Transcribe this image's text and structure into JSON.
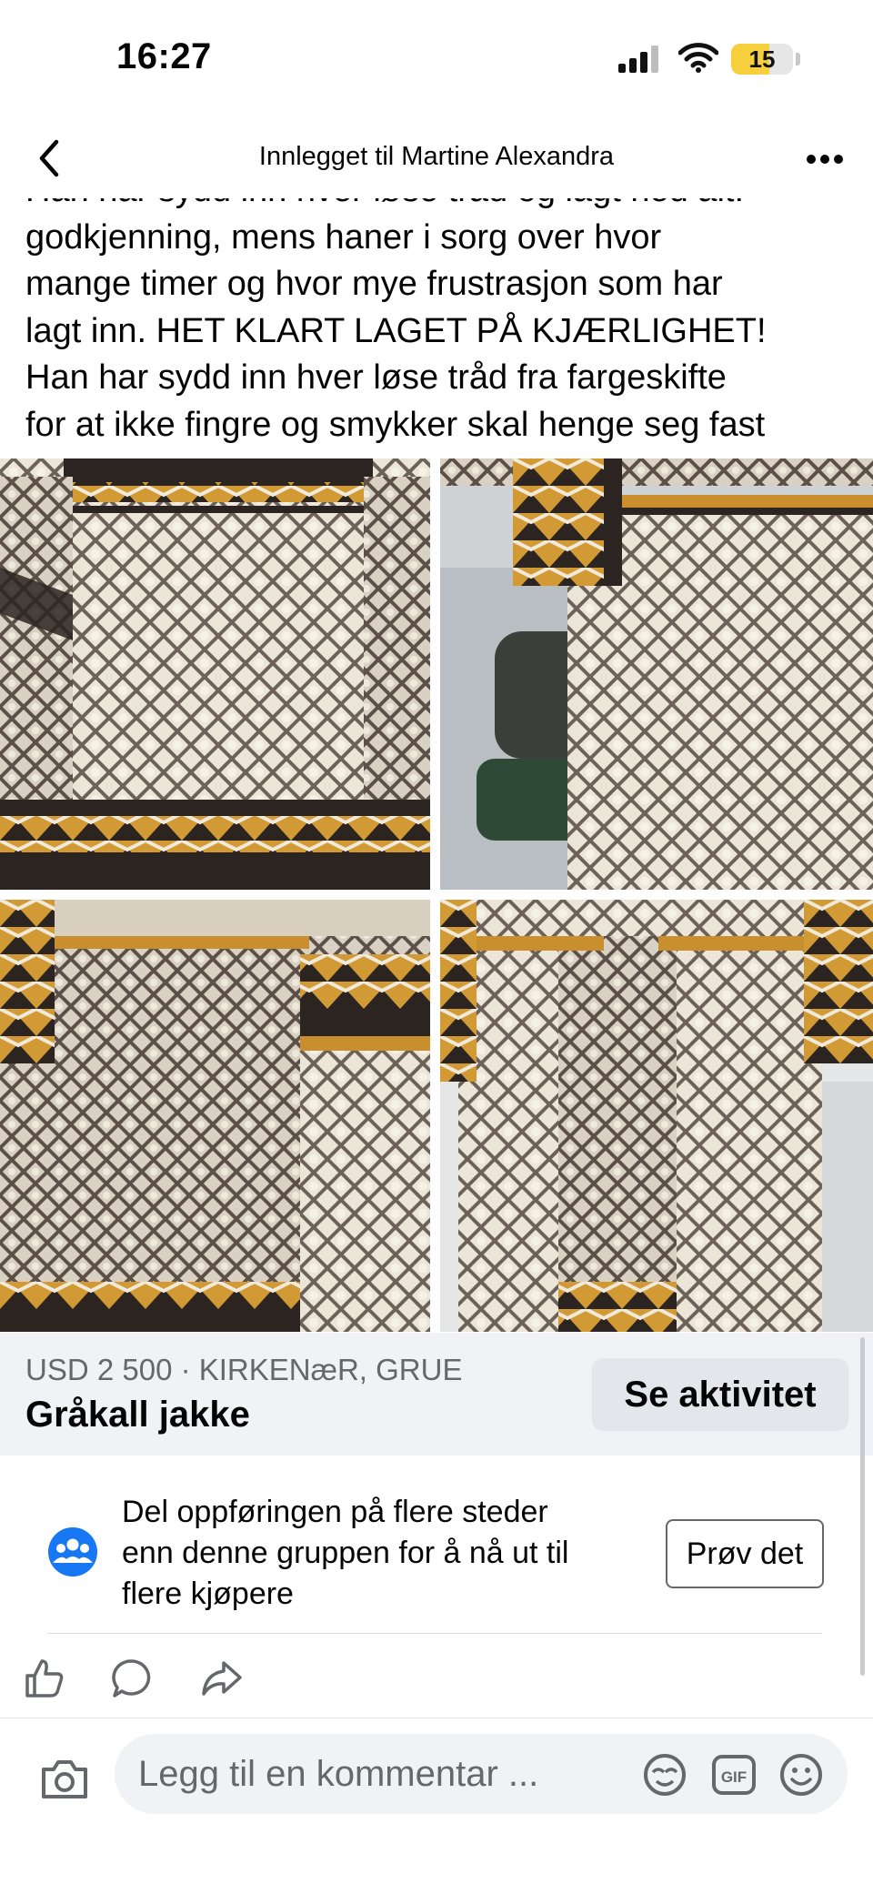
{
  "status_bar": {
    "time": "16:27",
    "battery": "15"
  },
  "nav": {
    "title": "Innlegget til Martine Alexandra"
  },
  "caption": {
    "lines": [
      "Han har sydd inn hver løse tråd og lagt ned alt.",
      "godkjenning, mens haner i sorg over hvor",
      "mange timer og hvor mye frustrasjon som har",
      "lagt inn. HET KLART LAGET PÅ KJÆRLIGHET!",
      "Han har sydd inn hver løse tråd fra fargeskifte",
      "for at ikke fingre og smykker skal henge seg fast"
    ]
  },
  "photos": [
    {
      "name": "photo-sweater-back"
    },
    {
      "name": "photo-sweater-side"
    },
    {
      "name": "photo-sweater-inside"
    },
    {
      "name": "photo-sweater-open"
    }
  ],
  "listing": {
    "price_location": "USD 2 500 · KIRKENæR, GRUE",
    "title": "Gråkall jakke",
    "activity_label": "Se aktivitet"
  },
  "share_prompt": {
    "lines": [
      "Del oppføringen på flere steder",
      "enn denne gruppen for å nå ut til",
      "flere kjøpere"
    ],
    "button_label": "Prøv det"
  },
  "comment": {
    "placeholder": "Legg til en kommentar ..."
  },
  "icons": {
    "back": "chevron-left-icon",
    "more": "more-horizontal-icon",
    "like": "thumbs-up-icon",
    "comment": "speech-bubble-icon",
    "share": "share-arrow-icon",
    "camera": "camera-icon",
    "avatar": "avatar-sticker-icon",
    "gif": "gif-icon",
    "emoji": "emoji-smile-icon",
    "group": "group-people-icon"
  },
  "colors": {
    "accent": "#1877f2",
    "secondary_text": "#65676b",
    "listing_bg": "#f0f2f5"
  }
}
